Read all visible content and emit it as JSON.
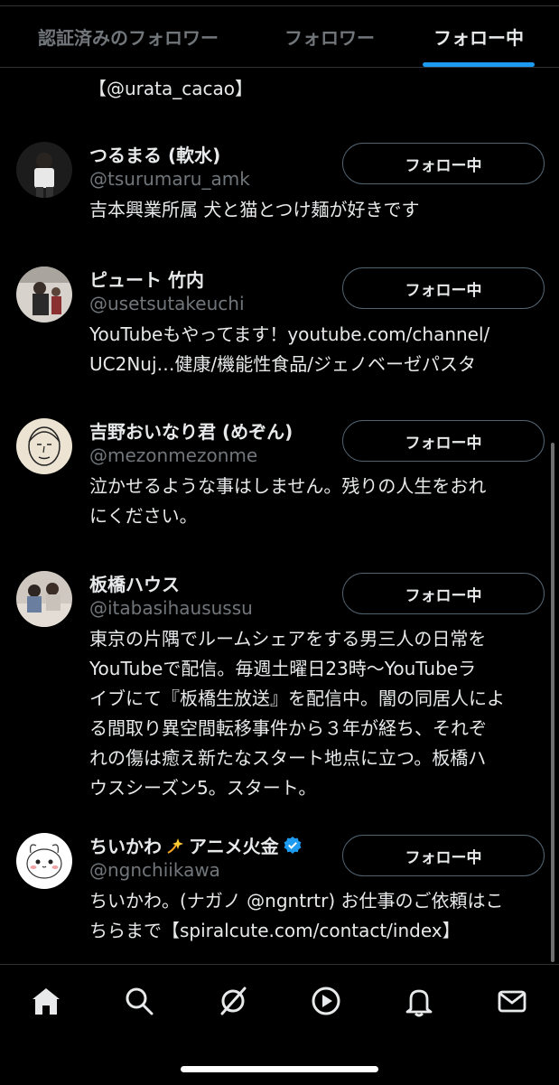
{
  "tabs": [
    {
      "label": "認証済みのフォロワー",
      "active": false
    },
    {
      "label": "フォロワー",
      "active": false
    },
    {
      "label": "フォロー中",
      "active": true
    }
  ],
  "previous_bio_tail": "【@urata_cacao】",
  "users": [
    {
      "name": "つるまる (軟水)",
      "handle": "@tsurumaru_amk",
      "bio": [
        "吉本興業所属 犬と猫とつけ麺が好きです"
      ],
      "button": "フォロー中"
    },
    {
      "name": "ピュート 竹内",
      "handle": "@usetsutakeuchi",
      "bio": [
        "YouTubeもやってます！youtube.com/channel/",
        "UC2Nuj…健康/機能性食品/ジェノベーゼパスタ"
      ],
      "button": "フォロー中"
    },
    {
      "name": "吉野おいなり君 (めぞん)",
      "handle": "@mezonmezonme",
      "bio": [
        "泣かせるような事はしません。残りの人生をおれ",
        "にください。"
      ],
      "button": "フォロー中"
    },
    {
      "name": "板橋ハウス",
      "handle": "@itabasihausussu",
      "bio": [
        "東京の片隅でルームシェアをする男三人の日常を",
        "YouTubeで配信。毎週土曜日23時〜YouTubeラ",
        "イブにて『板橋生放送』を配信中。闇の同居人によ",
        "る間取り異空間転移事件から３年が経ち、それぞ",
        "れの傷は癒え新たなスタート地点に立つ。板橋ハ",
        "ウスシーズン5。スタート。"
      ],
      "button": "フォロー中"
    },
    {
      "name_prefix": "ちいかわ",
      "name_suffix": "アニメ火金",
      "name_emoji": "dizzy-sparkle-icon",
      "verified": true,
      "handle": "@ngnchiikawa",
      "bio": [
        "ちいかわ。(ナガノ @ngntrtr) お仕事のご依頼はこ",
        "ちらまで【spiralcute.com/contact/index】"
      ],
      "button": "フォロー中"
    }
  ],
  "bottom_nav": [
    "home-icon",
    "search-icon",
    "grok-icon",
    "play-icon",
    "notifications-icon",
    "messages-icon"
  ],
  "colors": {
    "accent": "#1d9bf0",
    "background": "#000000",
    "text": "#e7e9ea",
    "secondary": "#71767b"
  }
}
